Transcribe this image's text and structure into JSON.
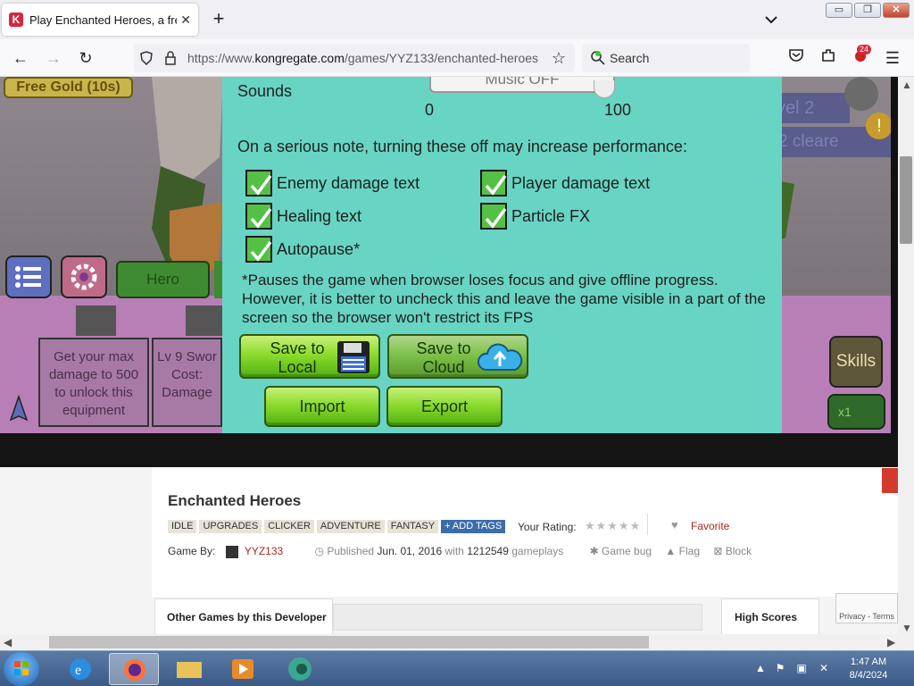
{
  "browser": {
    "tab_title": "Play Enchanted Heroes, a free o",
    "url_prefix": "https://www.",
    "url_domain": "kongregate.com",
    "url_path": "/games/YYZ133/enchanted-heroes",
    "search_placeholder": "Search",
    "extension_badge": "24"
  },
  "game": {
    "free_gold": "Free Gold (10s)",
    "hero_tab": "Hero",
    "level_text": "vel 2",
    "cleared_text": "2 cleare",
    "equip_card_1": "Get your max damage to 500 to unlock this equipment",
    "equip_card_2": "Lv 9 Swor Cost: Damage",
    "skills": "Skills",
    "multiplier": "x1"
  },
  "settings": {
    "music_button": "Music OFF",
    "sounds_label": "Sounds",
    "range_min": "0",
    "range_max": "100",
    "note": "On a serious note, turning these off may increase performance:",
    "options": [
      {
        "label": "Enemy damage text",
        "checked": true
      },
      {
        "label": "Player damage text",
        "checked": true
      },
      {
        "label": "Healing text",
        "checked": true
      },
      {
        "label": "Particle FX",
        "checked": true
      },
      {
        "label": "Autopause*",
        "checked": true
      }
    ],
    "footnote": "*Pauses the game when browser loses focus and give offline progress. However, it is better to uncheck this and leave the game visible in a part of the screen so the browser won't restrict its FPS",
    "save_local_1": "Save to",
    "save_local_2": "Local",
    "save_cloud_1": "Save to",
    "save_cloud_2": "Cloud",
    "import": "Import",
    "export": "Export"
  },
  "page": {
    "game_title": "Enchanted Heroes",
    "tags": [
      "IDLE",
      "UPGRADES",
      "CLICKER",
      "ADVENTURE",
      "FANTASY"
    ],
    "add_tags": "+ ADD TAGS",
    "your_rating": "Your Rating:",
    "stars": "★★★★★",
    "favorite": "Favorite",
    "game_by": "Game By:",
    "developer": "YYZ133",
    "published_label": "Published",
    "published_date": "Jun. 01, 2016",
    "with": "with",
    "gameplays_count": "1212549",
    "gameplays": "gameplays",
    "game_bug": "Game bug",
    "flag": "Flag",
    "block": "Block",
    "other_games_tab": "Other Games by this Developer",
    "high_scores_tab": "High Scores",
    "recaptcha": "Privacy - Terms"
  },
  "taskbar": {
    "time": "1:47 AM",
    "date": "8/4/2024"
  }
}
